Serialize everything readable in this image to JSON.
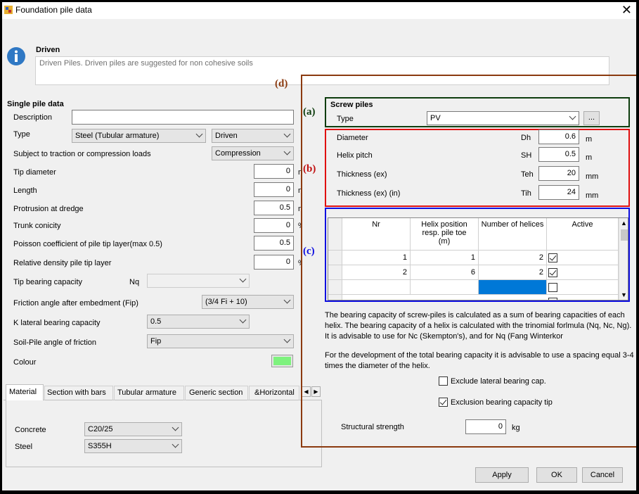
{
  "window": {
    "title": "Foundation pile data",
    "close_label": "✕"
  },
  "info": {
    "heading": "Driven",
    "description": "Driven Piles. Driven piles are suggested for non cohesive soils"
  },
  "single_pile": {
    "section_title": "Single pile data",
    "fields": {
      "description": {
        "label": "Description",
        "value": ""
      },
      "type": {
        "label": "Type",
        "value1": "Steel (Tubular armature)",
        "value2": "Driven"
      },
      "traction": {
        "label": "Subject to traction or compression loads",
        "value": "Compression"
      },
      "tip_diameter": {
        "label": "Tip diameter",
        "value": "0",
        "unit": "m"
      },
      "length": {
        "label": "Length",
        "value": "0",
        "unit": "m"
      },
      "protrusion": {
        "label": "Protrusion at dredge",
        "value": "0.5",
        "unit": "m"
      },
      "trunk_conicity": {
        "label": "Trunk conicity",
        "value": "0",
        "unit": "%"
      },
      "poisson": {
        "label": "Poisson coefficient of pile tip layer(max 0.5)",
        "value": "0.5"
      },
      "relative_density": {
        "label": "Relative density pile tip layer",
        "value": "0",
        "unit": "%"
      },
      "tip_bearing": {
        "label": "Tip bearing capacity",
        "sub_label": "Nq",
        "value": ""
      },
      "friction_angle": {
        "label": "Friction angle after embedment (Fip)",
        "value": "(3/4 Fi + 10)"
      },
      "k_lateral": {
        "label": "K lateral bearing capacity",
        "value": "0.5"
      },
      "soil_pile": {
        "label": "Soil-Pile  angle of friction",
        "value": "Fip"
      },
      "colour": {
        "label": "Colour",
        "value": "#7ef27e"
      }
    }
  },
  "tabs": [
    "Material",
    "Section with bars",
    "Tubular armature",
    "Generic section",
    "&Horizontal"
  ],
  "material": {
    "concrete": {
      "label": "Concrete",
      "value": "C20/25"
    },
    "steel": {
      "label": "Steel",
      "value": "S355H"
    }
  },
  "annotations": {
    "a": "(a)",
    "b": "(b)",
    "c": "(c)",
    "d": "(d)"
  },
  "screw": {
    "title": "Screw piles",
    "type_label": "Type",
    "type_value": "PV",
    "browse_label": "...",
    "diameter": {
      "label": "Diameter",
      "sym": "Dh",
      "value": "0.6",
      "unit": "m"
    },
    "helix_pitch": {
      "label": "Helix pitch",
      "sym": "SH",
      "value": "0.5",
      "unit": "m"
    },
    "thickness": {
      "label": "Thickness (ex)",
      "sym": "Teh",
      "value": "20",
      "unit": "mm"
    },
    "thickness_in": {
      "label": "Thickness (ex) (in)",
      "sym": "Tih",
      "value": "24",
      "unit": "mm"
    }
  },
  "grid": {
    "headers": [
      "Nr",
      "Helix position resp. pile toe (m)",
      "Number of helices",
      "Active"
    ],
    "rows": [
      {
        "nr": "1",
        "pos": "1",
        "num": "2",
        "active": true
      },
      {
        "nr": "2",
        "pos": "6",
        "num": "2",
        "active": true
      },
      {
        "nr": "",
        "pos": "",
        "num": "",
        "active": false
      }
    ]
  },
  "notes": {
    "p1": "The bearing capacity of screw-piles is calculated as a sum of bearing capacities of each helix. The bearing capacity of a helix is calculated with the trinomial forlmula (Nq, Nc, Ng).  It is advisable to use for Nc (Skempton's), and for Nq (Fang  Winterkor",
    "p2": "For the development of the total bearing capacity it is advisable to use a spacing equal 3-4 times the diameter of the helix."
  },
  "options": {
    "exclude_lateral": {
      "label": "Exclude lateral bearing cap.",
      "checked": false
    },
    "exclusion_tip": {
      "label": "Exclusion bearing capacity tip",
      "checked": true
    }
  },
  "structural": {
    "label": "Structural strength",
    "value": "0",
    "unit": "kg"
  },
  "buttons": {
    "apply": "Apply",
    "ok": "OK",
    "cancel": "Cancel"
  }
}
